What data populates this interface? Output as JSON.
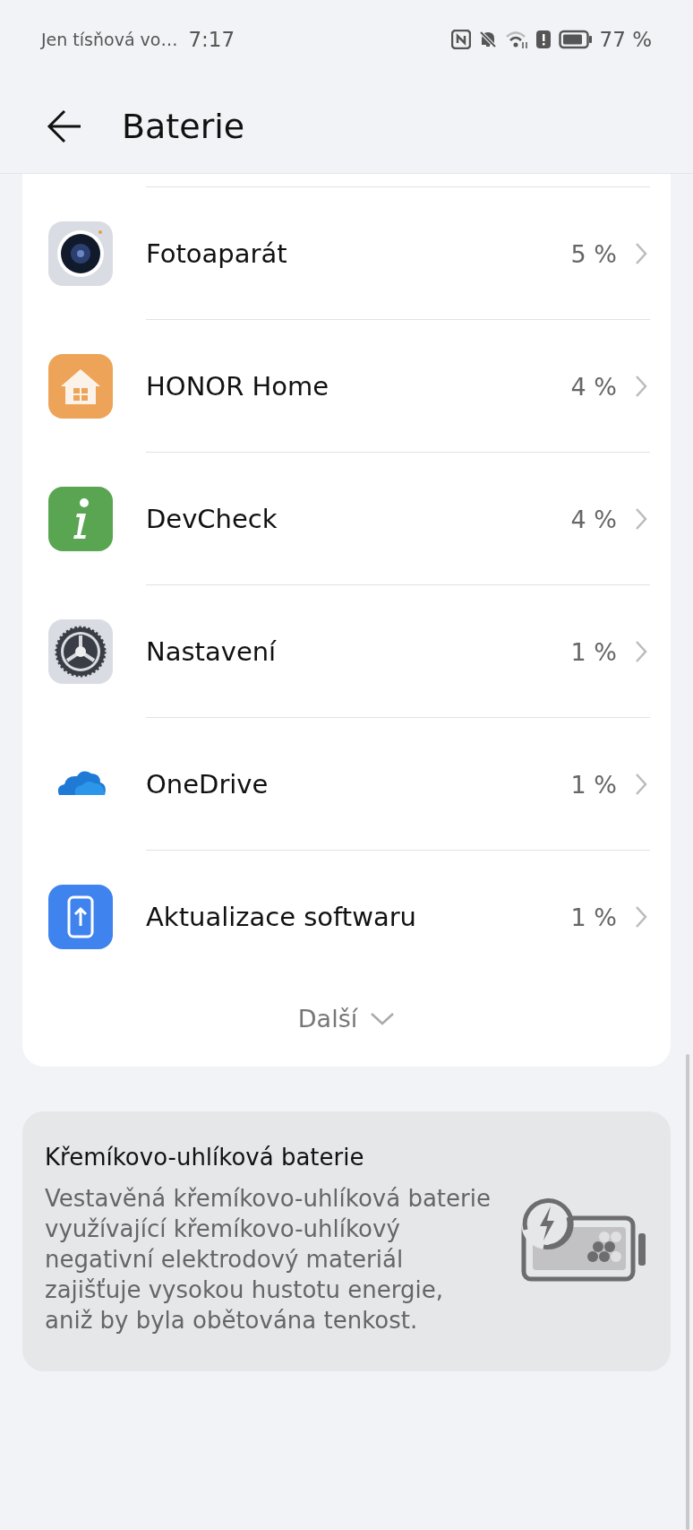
{
  "status_bar": {
    "carrier": "Jen tísňová vo…",
    "time": "7:17",
    "battery": "77 %"
  },
  "header": {
    "title": "Baterie"
  },
  "apps": [
    {
      "kind": "camera",
      "name": "Fotoaparát",
      "usage": "5 %"
    },
    {
      "kind": "home",
      "name": "HONOR Home",
      "usage": "4 %"
    },
    {
      "kind": "info",
      "name": "DevCheck",
      "usage": "4 %"
    },
    {
      "kind": "gear",
      "name": "Nastavení",
      "usage": "1 %"
    },
    {
      "kind": "cloud",
      "name": "OneDrive",
      "usage": "1 %"
    },
    {
      "kind": "update",
      "name": "Aktualizace softwaru",
      "usage": "1 %"
    }
  ],
  "more": {
    "label": "Další"
  },
  "info_card": {
    "title": "Křemíkovo-uhlíková baterie",
    "text": "Vestavěná křemíkovo-uhlíková baterie využívající křemíkovo-uhlíkový negativní elektrodový materiál zajišťuje vysokou hustotu energie, aniž by byla obětována tenkost."
  }
}
